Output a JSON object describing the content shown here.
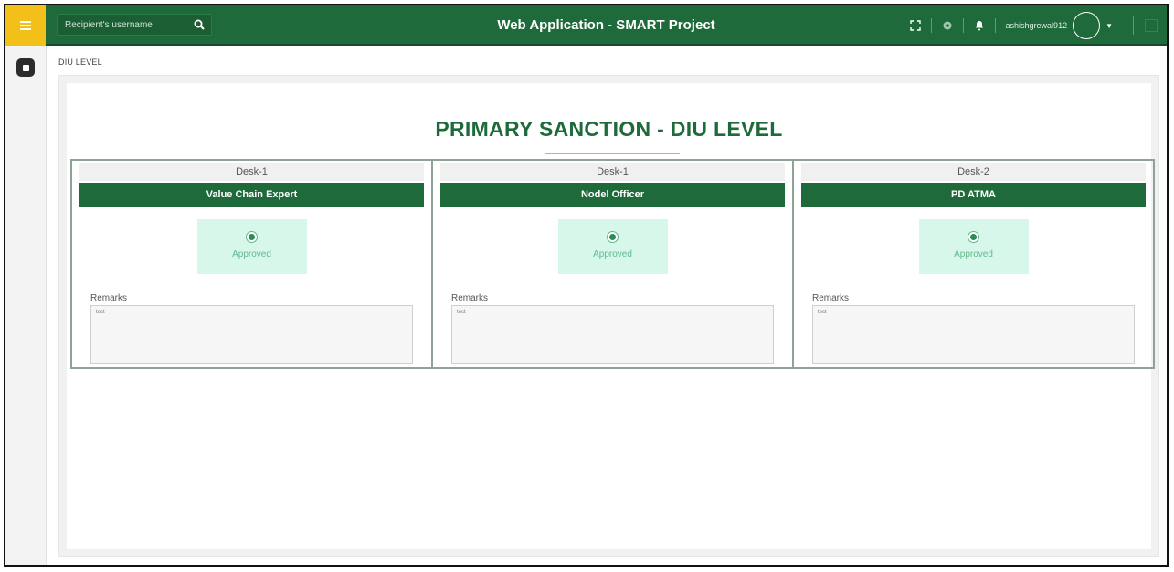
{
  "header": {
    "title": "Web Application - SMART Project",
    "search_placeholder": "Recipient's username",
    "username": "ashishgrewal912"
  },
  "breadcrumb": "DIU LEVEL",
  "page": {
    "title": "PRIMARY SANCTION - DIU LEVEL"
  },
  "desks": [
    {
      "desk": "Desk-1",
      "role": "Value Chain Expert",
      "status": "Approved",
      "remarks_label": "Remarks",
      "remarks": "test"
    },
    {
      "desk": "Desk-1",
      "role": "Nodel Officer",
      "status": "Approved",
      "remarks_label": "Remarks",
      "remarks": "test"
    },
    {
      "desk": "Desk-2",
      "role": "PD ATMA",
      "status": "Approved",
      "remarks_label": "Remarks",
      "remarks": "test"
    }
  ],
  "colors": {
    "header_green": "#1e6a3a",
    "accent_yellow": "#f2c018",
    "approved_bg": "#d6f7ea",
    "title_underline": "#e2b13a"
  }
}
